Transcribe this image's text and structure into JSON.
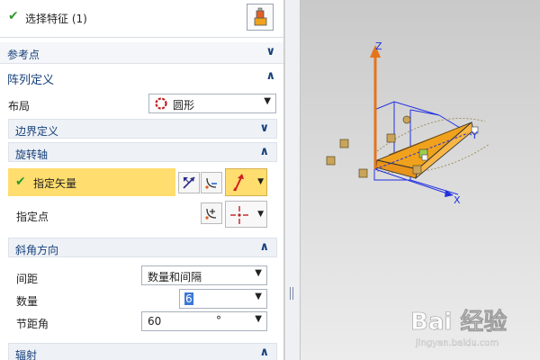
{
  "header": {
    "title": "选择特征 (1)",
    "icon": "select-feature-icon"
  },
  "sections": {
    "ref_point": {
      "label": "参考点",
      "state": "collapsed"
    },
    "array_def": {
      "label": "阵列定义",
      "state": "expanded"
    }
  },
  "layout": {
    "label": "布局",
    "value": "圆形",
    "icon": "circle-pattern-icon"
  },
  "boundary": {
    "label": "边界定义",
    "state": "collapsed"
  },
  "rotation_axis": {
    "label": "旋转轴",
    "state": "expanded",
    "specify_vector": {
      "label": "指定矢量",
      "highlight": "#ffdd6e"
    },
    "specify_point": {
      "label": "指定点"
    }
  },
  "angle_direction": {
    "label": "斜角方向",
    "state": "expanded",
    "spacing": {
      "label": "间距",
      "value": "数量和间隔"
    },
    "count": {
      "label": "数量",
      "value": "6"
    },
    "pitch_angle": {
      "label": "节距角",
      "value": "60",
      "unit": "°"
    }
  },
  "radial": {
    "label": "辐射",
    "state": "expanded"
  },
  "viewport": {
    "axes": {
      "x": "X",
      "y": "Y",
      "z": "Z"
    },
    "watermark_main": "Bai 经验",
    "watermark_url": "jingyan.baidu.com"
  },
  "colors": {
    "accent": "#16407a",
    "check": "#2e9b2e",
    "model_orange": "#f0a21c",
    "axis_blue": "#2231e0"
  }
}
